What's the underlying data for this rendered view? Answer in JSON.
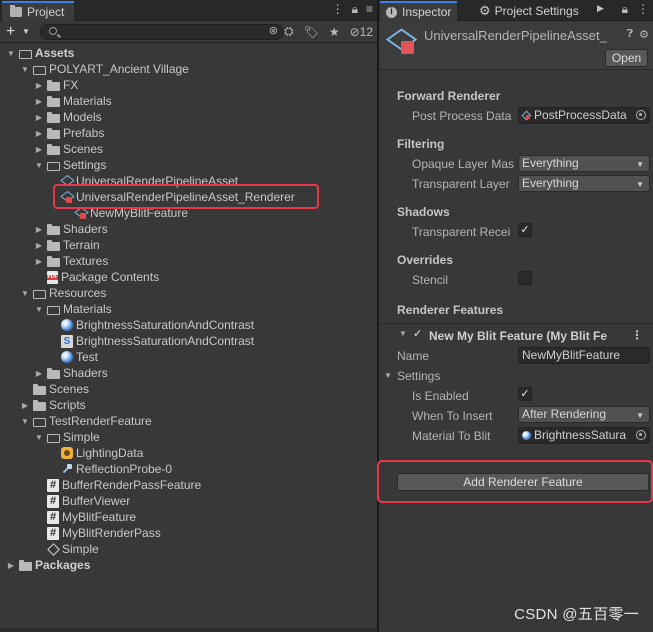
{
  "project": {
    "tab_label": "Project",
    "hidden_count": "12",
    "tree": [
      {
        "label": "Assets",
        "depth": 0,
        "arrow": "open",
        "icon": "folder-open-icon",
        "bold": true
      },
      {
        "label": "POLYART_Ancient Village",
        "depth": 1,
        "arrow": "open",
        "icon": "folder-open-icon"
      },
      {
        "label": "FX",
        "depth": 2,
        "arrow": "closed",
        "icon": "folder-icon"
      },
      {
        "label": "Materials",
        "depth": 2,
        "arrow": "closed",
        "icon": "folder-icon"
      },
      {
        "label": "Models",
        "depth": 2,
        "arrow": "closed",
        "icon": "folder-icon"
      },
      {
        "label": "Prefabs",
        "depth": 2,
        "arrow": "closed",
        "icon": "folder-icon"
      },
      {
        "label": "Scenes",
        "depth": 2,
        "arrow": "closed",
        "icon": "folder-icon"
      },
      {
        "label": "Settings",
        "depth": 2,
        "arrow": "open",
        "icon": "folder-open-icon"
      },
      {
        "label": "UniversalRenderPipelineAsset",
        "depth": 3,
        "arrow": "none",
        "icon": "pipeline-asset-icon"
      },
      {
        "label": "UniversalRenderPipelineAsset_Renderer",
        "depth": 3,
        "arrow": "none",
        "icon": "renderer-asset-icon"
      },
      {
        "label": "NewMyBlitFeature",
        "depth": 4,
        "arrow": "none",
        "icon": "renderer-asset-icon"
      },
      {
        "label": "Shaders",
        "depth": 2,
        "arrow": "closed",
        "icon": "folder-icon"
      },
      {
        "label": "Terrain",
        "depth": 2,
        "arrow": "closed",
        "icon": "folder-icon"
      },
      {
        "label": "Textures",
        "depth": 2,
        "arrow": "closed",
        "icon": "folder-icon"
      },
      {
        "label": "Package Contents",
        "depth": 2,
        "arrow": "none",
        "icon": "pdf-icon"
      },
      {
        "label": "Resources",
        "depth": 1,
        "arrow": "open",
        "icon": "folder-open-icon"
      },
      {
        "label": "Materials",
        "depth": 2,
        "arrow": "open",
        "icon": "folder-open-icon"
      },
      {
        "label": "BrightnessSaturationAndContrast",
        "depth": 3,
        "arrow": "none",
        "icon": "material-icon"
      },
      {
        "label": "BrightnessSaturationAndContrast",
        "depth": 3,
        "arrow": "none",
        "icon": "shader-icon"
      },
      {
        "label": "Test",
        "depth": 3,
        "arrow": "none",
        "icon": "material-icon"
      },
      {
        "label": "Shaders",
        "depth": 2,
        "arrow": "closed",
        "icon": "folder-icon"
      },
      {
        "label": "Scenes",
        "depth": 1,
        "arrow": "none",
        "icon": "folder-icon"
      },
      {
        "label": "Scripts",
        "depth": 1,
        "arrow": "closed",
        "icon": "folder-icon"
      },
      {
        "label": "TestRenderFeature",
        "depth": 1,
        "arrow": "open",
        "icon": "folder-open-icon"
      },
      {
        "label": "Simple",
        "depth": 2,
        "arrow": "open",
        "icon": "folder-open-icon"
      },
      {
        "label": "LightingData",
        "depth": 3,
        "arrow": "none",
        "icon": "lighting-data-icon"
      },
      {
        "label": "ReflectionProbe-0",
        "depth": 3,
        "arrow": "none",
        "icon": "reflection-probe-icon"
      },
      {
        "label": "BufferRenderPassFeature",
        "depth": 2,
        "arrow": "none",
        "icon": "csharp-script-icon"
      },
      {
        "label": "BufferViewer",
        "depth": 2,
        "arrow": "none",
        "icon": "csharp-script-icon"
      },
      {
        "label": "MyBlitFeature",
        "depth": 2,
        "arrow": "none",
        "icon": "csharp-script-icon"
      },
      {
        "label": "MyBlitRenderPass",
        "depth": 2,
        "arrow": "none",
        "icon": "csharp-script-icon"
      },
      {
        "label": "Simple",
        "depth": 2,
        "arrow": "none",
        "icon": "unity-scene-icon"
      },
      {
        "label": "Packages",
        "depth": 0,
        "arrow": "closed",
        "icon": "folder-icon",
        "bold": true
      }
    ]
  },
  "inspector": {
    "tab_inspector": "Inspector",
    "tab_project_settings": "Project Settings",
    "asset_title": "UniversalRenderPipelineAsset_",
    "open_label": "Open",
    "forward_renderer": {
      "section": "Forward Renderer",
      "post_process_label": "Post Process Data",
      "post_process_value": "PostProcessData"
    },
    "filtering": {
      "section": "Filtering",
      "opaque_label": "Opaque Layer Mas",
      "opaque_value": "Everything",
      "transparent_label": "Transparent Layer",
      "transparent_value": "Everything"
    },
    "shadows": {
      "section": "Shadows",
      "transparent_receive_label": "Transparent Recei",
      "transparent_receive_checked": "✓"
    },
    "overrides": {
      "section": "Overrides",
      "stencil_label": "Stencil"
    },
    "renderer_features": {
      "section": "Renderer Features",
      "feature_title": "New My Blit Feature (My Blit Fe",
      "feature_enabled": "✓",
      "name_label": "Name",
      "name_value": "NewMyBlitFeature",
      "settings_label": "Settings",
      "is_enabled_label": "Is Enabled",
      "is_enabled_checked": "✓",
      "when_to_insert_label": "When To Insert",
      "when_to_insert_value": "After Rendering",
      "material_label": "Material To Blit",
      "material_value": "BrightnessSatura"
    },
    "add_feature_label": "Add Renderer Feature"
  },
  "watermark": "CSDN @五百零一",
  "colors": {
    "highlight": "#e8364a",
    "tab_accent": "#3d7fe0",
    "panel_bg": "#383838"
  }
}
